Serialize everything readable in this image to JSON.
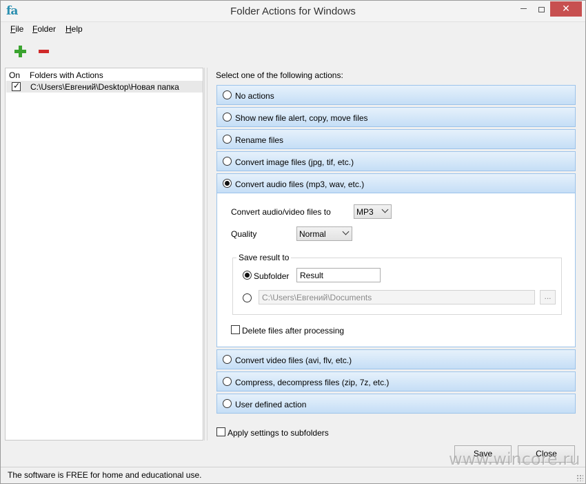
{
  "window": {
    "title": "Folder Actions for Windows",
    "app_icon_text": "fa",
    "close_glyph": "✕"
  },
  "menu": [
    "File",
    "Folder",
    "Help"
  ],
  "toolbar": {
    "add_icon": "plus-icon",
    "remove_icon": "minus-icon"
  },
  "folders": {
    "col_on": "On",
    "col_folders": "Folders with Actions",
    "rows": [
      {
        "checked": true,
        "path": "C:\\Users\\Евгений\\Desktop\\Новая папка"
      }
    ]
  },
  "actions_prompt": "Select one of the following actions:",
  "actions": [
    {
      "label": "No actions",
      "selected": false
    },
    {
      "label": "Show new file alert, copy, move files",
      "selected": false
    },
    {
      "label": "Rename files",
      "selected": false
    },
    {
      "label": "Convert image files (jpg, tif, etc.)",
      "selected": false
    },
    {
      "label": "Convert audio files (mp3, wav, etc.)",
      "selected": true
    },
    {
      "label": "Convert video files (avi, flv, etc.)",
      "selected": false
    },
    {
      "label": "Compress, decompress files (zip, 7z, etc.)",
      "selected": false
    },
    {
      "label": "User defined action",
      "selected": false
    }
  ],
  "audio": {
    "convert_label": "Convert audio/video files to",
    "format_value": "MP3",
    "quality_label": "Quality",
    "quality_value": "Normal",
    "save_group_title": "Save result to",
    "subfolder_label": "Subfolder",
    "subfolder_value": "Result",
    "path_value": "C:\\Users\\Евгений\\Documents",
    "browse_label": "...",
    "delete_label": "Delete files after processing"
  },
  "apply_subfolders_label": "Apply settings to subfolders",
  "buttons": {
    "save": "Save",
    "close": "Close"
  },
  "status": "The software is FREE for home and educational use.",
  "watermark": "www.wincore.ru"
}
